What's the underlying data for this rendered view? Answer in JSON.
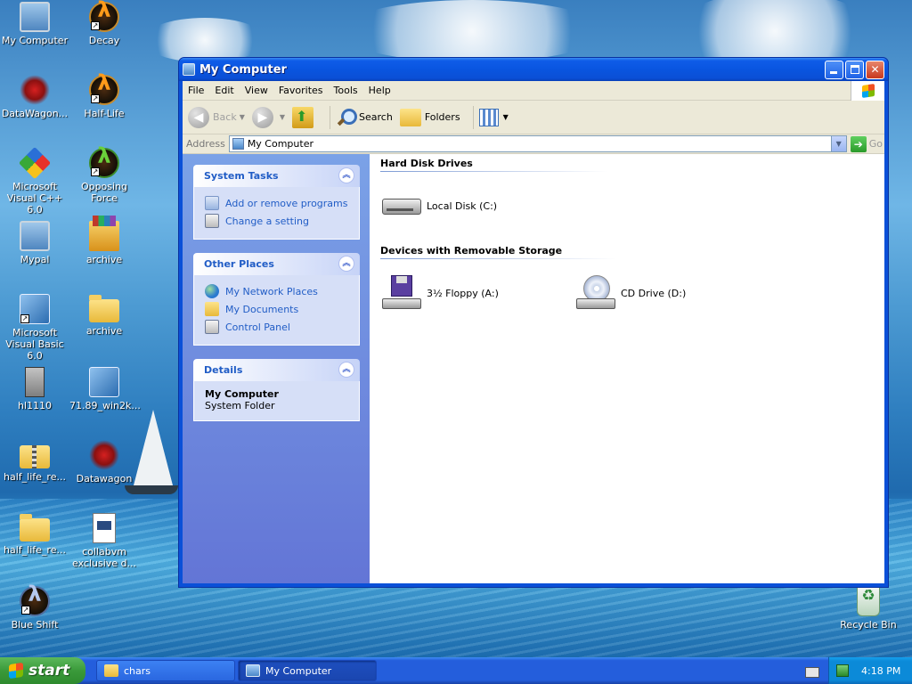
{
  "desktop": {
    "icons": [
      {
        "label": "My Computer"
      },
      {
        "label": "Decay"
      },
      {
        "label": "DataWagon..."
      },
      {
        "label": "Half-Life"
      },
      {
        "label": "Microsoft Visual C++ 6.0"
      },
      {
        "label": "Opposing Force"
      },
      {
        "label": "Mypal"
      },
      {
        "label": "archive"
      },
      {
        "label": "Microsoft Visual Basic 6.0"
      },
      {
        "label": "archive"
      },
      {
        "label": "hl1110"
      },
      {
        "label": "71.89_win2k..."
      },
      {
        "label": "half_life_re..."
      },
      {
        "label": "Datawagon"
      },
      {
        "label": "half_life_re..."
      },
      {
        "label": "collabvm exclusive d..."
      },
      {
        "label": "Blue Shift"
      },
      {
        "label": "Recycle Bin"
      }
    ]
  },
  "window": {
    "title": "My Computer",
    "menu": [
      "File",
      "Edit",
      "View",
      "Favorites",
      "Tools",
      "Help"
    ],
    "toolbar": {
      "back_label": "Back",
      "search_label": "Search",
      "folders_label": "Folders"
    },
    "address": {
      "label": "Address",
      "value": "My Computer",
      "go_label": "Go"
    },
    "taskpane": {
      "system_tasks": {
        "title": "System Tasks",
        "links": [
          "Add or remove programs",
          "Change a setting"
        ]
      },
      "other_places": {
        "title": "Other Places",
        "links": [
          "My Network Places",
          "My Documents",
          "Control Panel"
        ]
      },
      "details": {
        "title": "Details",
        "name": "My Computer",
        "type": "System Folder"
      }
    },
    "groups": [
      {
        "title": "Hard Disk Drives",
        "items": [
          "Local Disk (C:)"
        ]
      },
      {
        "title": "Devices with Removable Storage",
        "items": [
          "3½ Floppy (A:)",
          "CD Drive (D:)"
        ]
      }
    ]
  },
  "taskbar": {
    "start_label": "start",
    "tasks": [
      "chars",
      "My Computer"
    ],
    "clock": "4:18 PM"
  },
  "colors": {
    "titlebar_blue": "#0a55e0",
    "taskpane_link": "#215dc6",
    "start_green": "#3a9a3a"
  }
}
